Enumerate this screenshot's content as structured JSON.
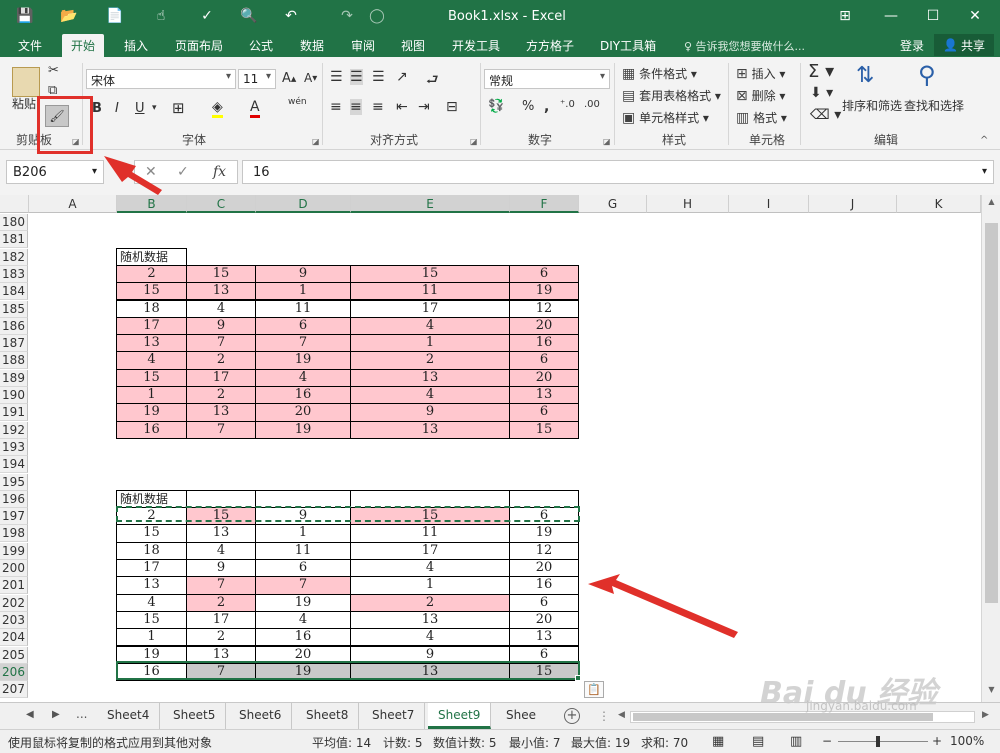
{
  "window": {
    "title": "Book1.xlsx - Excel",
    "controls": [
      "⊞",
      "—",
      "☐",
      "✕"
    ]
  },
  "quick_access": [
    "💾",
    "📂",
    "📄",
    "☝",
    "✓",
    "🔍",
    "↶",
    "↷",
    "◯"
  ],
  "ribbon_tabs": [
    "文件",
    "开始",
    "插入",
    "页面布局",
    "公式",
    "数据",
    "审阅",
    "视图",
    "开发工具",
    "方方格子",
    "DIY工具箱"
  ],
  "ribbon_active_tab": "开始",
  "tell_me": "♀ 告诉我您想要做什么...",
  "login_label": "登录",
  "share_label": "共享",
  "ribbon": {
    "clipboard": {
      "paste": "粘贴",
      "group": "剪贴板"
    },
    "font": {
      "name": "宋体",
      "size": "11",
      "group": "字体",
      "bold": "B",
      "italic": "I",
      "underline": "U",
      "wen": "wén"
    },
    "alignment": {
      "group": "对齐方式"
    },
    "number": {
      "format": "常规",
      "group": "数字"
    },
    "styles": {
      "conditional": "条件格式",
      "table_format": "套用表格格式",
      "cell_style": "单元格样式",
      "group": "样式"
    },
    "cells": {
      "insert": "插入",
      "delete": "删除",
      "format": "格式",
      "group": "单元格"
    },
    "editing": {
      "sort": "排序和筛选",
      "find": "查找和选择",
      "group": "编辑"
    }
  },
  "formula_bar": {
    "name_box": "B206",
    "value": "16",
    "cancel": "✕",
    "enter": "✓",
    "fx": "fx"
  },
  "columns": [
    "A",
    "B",
    "C",
    "D",
    "E",
    "F",
    "G",
    "H",
    "I",
    "J",
    "K"
  ],
  "rows": [
    "180",
    "181",
    "182",
    "183",
    "184",
    "185",
    "186",
    "187",
    "188",
    "189",
    "190",
    "191",
    "192",
    "193",
    "194",
    "195",
    "196",
    "197",
    "198",
    "199",
    "200",
    "201",
    "202",
    "203",
    "204",
    "205",
    "206",
    "207"
  ],
  "table1": {
    "header": "随机数据",
    "rows": [
      [
        2,
        15,
        9,
        15,
        6
      ],
      [
        15,
        13,
        1,
        11,
        19
      ],
      [
        18,
        4,
        11,
        17,
        12
      ],
      [
        17,
        9,
        6,
        4,
        20
      ],
      [
        13,
        7,
        7,
        1,
        16
      ],
      [
        4,
        2,
        19,
        2,
        6
      ],
      [
        15,
        17,
        4,
        13,
        20
      ],
      [
        1,
        2,
        16,
        4,
        13
      ],
      [
        19,
        13,
        20,
        9,
        6
      ],
      [
        16,
        7,
        19,
        13,
        15
      ]
    ]
  },
  "table2": {
    "header": "随机数据",
    "rows": [
      [
        2,
        15,
        9,
        15,
        6
      ],
      [
        15,
        13,
        1,
        11,
        19
      ],
      [
        18,
        4,
        11,
        17,
        12
      ],
      [
        17,
        9,
        6,
        4,
        20
      ],
      [
        13,
        7,
        7,
        1,
        16
      ],
      [
        4,
        2,
        19,
        2,
        6
      ],
      [
        15,
        17,
        4,
        13,
        20
      ],
      [
        1,
        2,
        16,
        4,
        13
      ],
      [
        19,
        13,
        20,
        9,
        6
      ],
      [
        16,
        7,
        19,
        13,
        15
      ]
    ]
  },
  "sheet_tabs": [
    "Sheet4",
    "Sheet5",
    "Sheet6",
    "Sheet8",
    "Sheet7",
    "Sheet9",
    "Shee"
  ],
  "active_sheet": "Sheet9",
  "sheet_nav": [
    "◀",
    "▶",
    "..."
  ],
  "status": {
    "message": "使用鼠标将复制的格式应用到其他对象",
    "average": "平均值: 14",
    "count": "计数: 5",
    "numeric_count": "数值计数: 5",
    "min": "最小值: 7",
    "max": "最大值: 19",
    "sum": "求和: 70",
    "zoom": "100%",
    "zoom_minus": "−",
    "zoom_plus": "+"
  },
  "watermark": {
    "brand": "Bai du 经验",
    "url": "jingyan.baidu.com"
  },
  "colors": {
    "excel_green": "#217346",
    "pink_fill": "#ffc7ce",
    "gray_fill": "#c9c9c9",
    "annotation_red": "#e0302a"
  }
}
